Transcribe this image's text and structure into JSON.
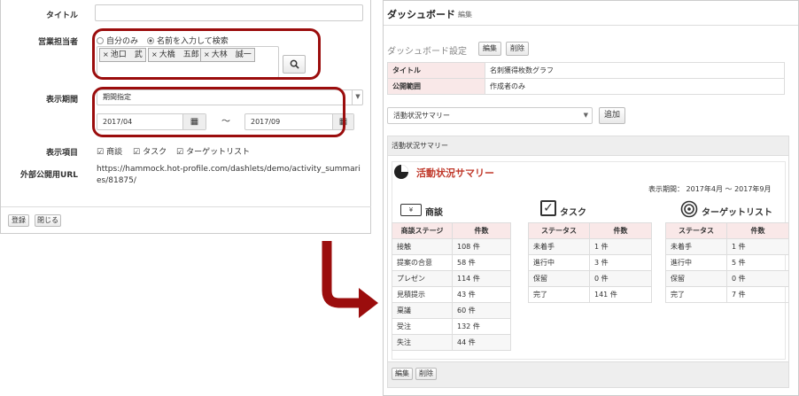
{
  "form": {
    "title_label": "タイトル",
    "title_value": "",
    "sales_label": "営業担当者",
    "radio_self": "自分のみ",
    "radio_search": "名前を入力して検索",
    "tags": [
      "池口　武",
      "大橋　五郎",
      "大林　誠一"
    ],
    "period_label": "表示期間",
    "period_select": "期間指定",
    "date_from": "2017/04",
    "date_sep": "～",
    "date_to": "2017/09",
    "items_label": "表示項目",
    "items": [
      "商談",
      "タスク",
      "ターゲットリスト"
    ],
    "url_label": "外部公開用URL",
    "url_value": "https://hammock.hot-profile.com/dashlets/demo/activity_summaries/81875/",
    "register_btn": "登録",
    "close_btn": "閉じる"
  },
  "dashboard": {
    "title": "ダッシュボード",
    "edit_link": "編集",
    "settings_title": "ダッシュボード設定",
    "edit_btn": "編集",
    "delete_btn": "削除",
    "info": [
      {
        "label": "タイトル",
        "value": "名刺獲得枚数グラフ"
      },
      {
        "label": "公開範囲",
        "value": "作成者のみ"
      }
    ],
    "add_select": "活動状況サマリー",
    "add_btn": "追加",
    "widget_header": "活動状況サマリー",
    "widget_title": "活動状況サマリー",
    "period_text": "表示期間： 2017年4月 ～ 2017年9月",
    "deals": {
      "title": "商談",
      "headers": [
        "商談ステージ",
        "件数"
      ],
      "rows": [
        [
          "接触",
          "108 件"
        ],
        [
          "提案の合意",
          "58 件"
        ],
        [
          "プレゼン",
          "114 件"
        ],
        [
          "見積提示",
          "43 件"
        ],
        [
          "稟議",
          "60 件"
        ],
        [
          "受注",
          "132 件"
        ],
        [
          "失注",
          "44 件"
        ]
      ]
    },
    "tasks": {
      "title": "タスク",
      "headers": [
        "ステータス",
        "件数"
      ],
      "rows": [
        [
          "未着手",
          "1 件"
        ],
        [
          "進行中",
          "3 件"
        ],
        [
          "保留",
          "0 件"
        ],
        [
          "完了",
          "141 件"
        ]
      ]
    },
    "targets": {
      "title": "ターゲットリスト",
      "headers": [
        "ステータス",
        "件数"
      ],
      "rows": [
        [
          "未着手",
          "1 件"
        ],
        [
          "進行中",
          "5 件"
        ],
        [
          "保留",
          "0 件"
        ],
        [
          "完了",
          "7 件"
        ]
      ]
    },
    "footer_edit": "編集",
    "footer_delete": "削除"
  },
  "colors": {
    "accent_red": "#9b0d0d",
    "widget_title_red": "#c0392b"
  }
}
